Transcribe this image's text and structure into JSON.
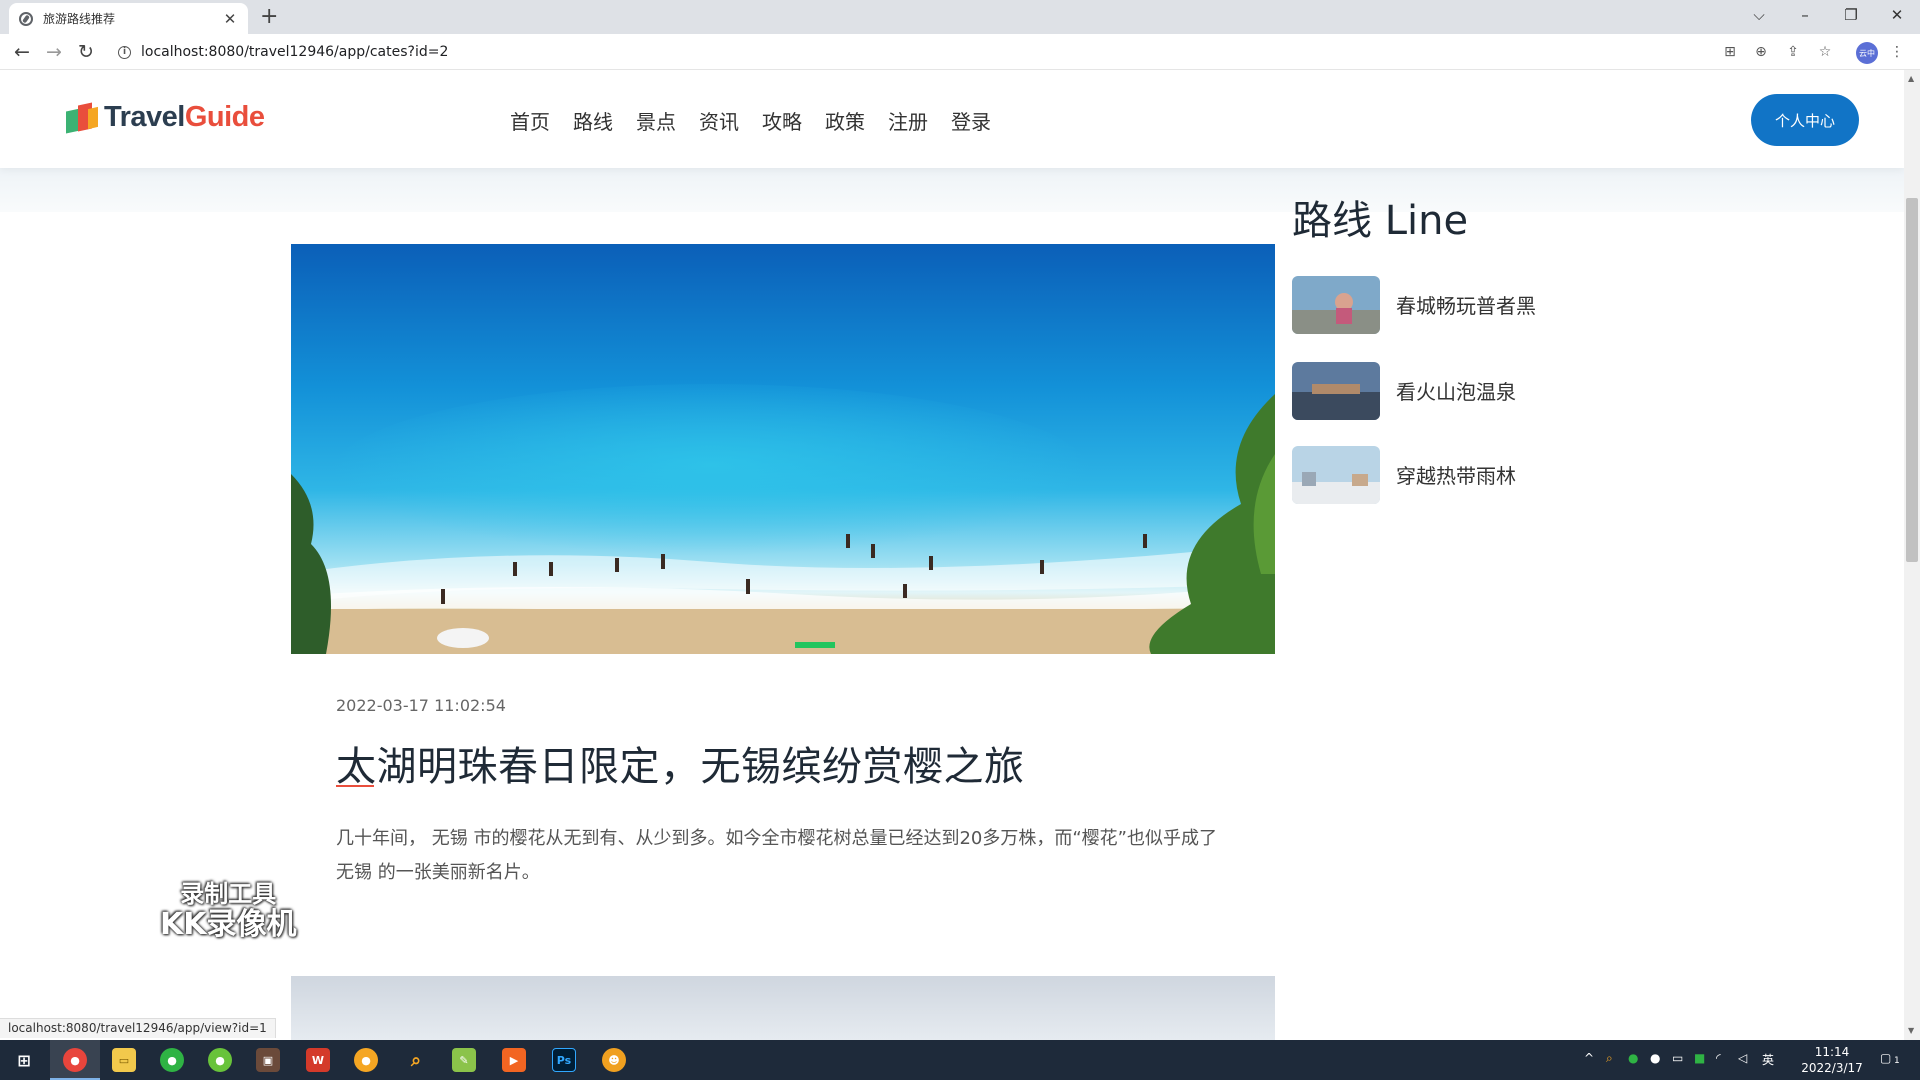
{
  "browser": {
    "tab_title": "旅游路线推荐",
    "tab_close": "✕",
    "new_tab": "+",
    "url": "localhost:8080/travel12946/app/cates?id=2",
    "status_url": "localhost:8080/travel12946/app/view?id=1",
    "profile_label": "云中",
    "icons": [
      "back-icon",
      "forward-icon",
      "reload-icon",
      "translate-icon",
      "zoom-icon",
      "share-icon",
      "bookmark-star-icon",
      "kebab-menu-icon"
    ]
  },
  "site": {
    "logo": {
      "part1": "Travel",
      "part2": "Guide"
    },
    "nav": [
      "首页",
      "路线",
      "景点",
      "资讯",
      "攻略",
      "政策",
      "注册",
      "登录"
    ],
    "personal_center": "个人中心"
  },
  "post": {
    "date": "2022-03-17 11:02:54",
    "title": "太湖明珠春日限定，无锡缤纷赏樱之旅",
    "excerpt": "几十年间， 无锡 市的樱花从无到有、从少到多。如今全市樱花树总量已经达到20多万株，而“樱花”也似乎成了 无锡 的一张美丽新名片。"
  },
  "sidebar": {
    "title": "路线 Line",
    "items": [
      {
        "label": "春城畅玩普者黑"
      },
      {
        "label": "看火山泡温泉"
      },
      {
        "label": "穿越热带雨林"
      }
    ]
  },
  "watermark": {
    "line1": "录制工具",
    "line2": "KK录像机"
  },
  "taskbar": {
    "time": "11:14",
    "date": "2022/3/17",
    "ime": "英",
    "notifications": "1"
  },
  "colors": {
    "accent": "#1174c6",
    "logo_red": "#e94e3c",
    "taskbar": "#1e2a3a"
  }
}
